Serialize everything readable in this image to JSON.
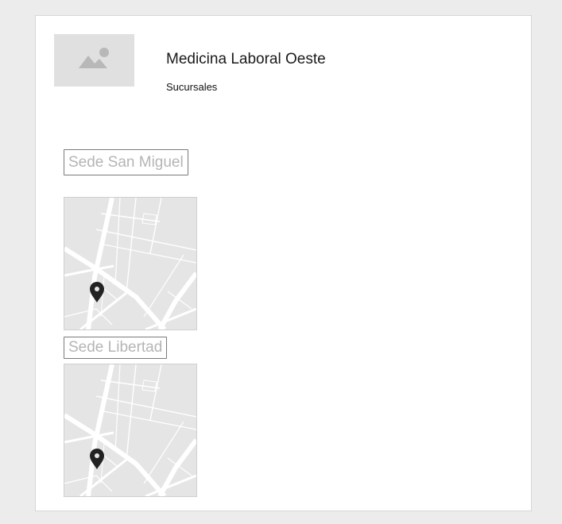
{
  "header": {
    "title": "Medicina Laboral Oeste",
    "subtitle": "Sucursales"
  },
  "icons": {
    "logo": "image-placeholder-icon",
    "map_pin": "map-pin-icon"
  },
  "branches": [
    {
      "label": "Sede San Miguel"
    },
    {
      "label": "Sede Libertad"
    }
  ],
  "colors": {
    "page_background": "#ececec",
    "card_background": "#ffffff",
    "placeholder": "#e0e0e0",
    "placeholder_glyph": "#b8b8b8",
    "map_background": "#e5e5e5",
    "button_text": "#b5b5b5",
    "pin": "#222222"
  }
}
